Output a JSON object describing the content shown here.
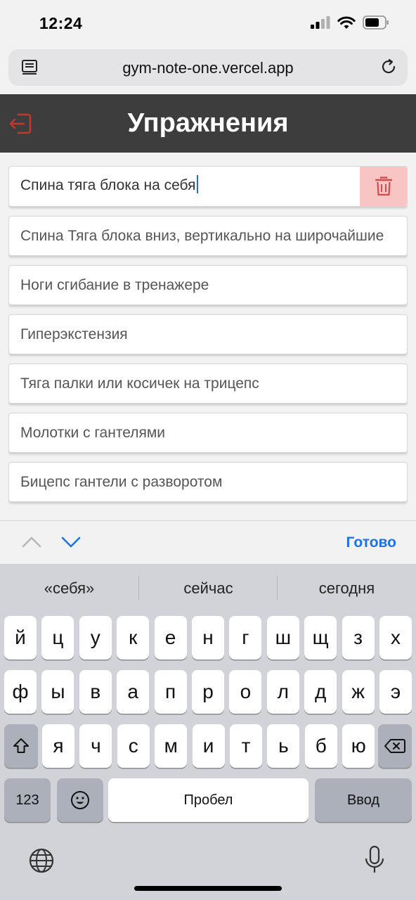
{
  "status_bar": {
    "time": "12:24"
  },
  "browser": {
    "url": "gym-note-one.vercel.app"
  },
  "header": {
    "title": "Упражнения"
  },
  "exercises": [
    {
      "name": "Спина тяга блока на себя",
      "editing": true
    },
    {
      "name": "Спина Тяга блока вниз, вертикально на широчайшие"
    },
    {
      "name": "Ноги сгибание в тренажере"
    },
    {
      "name": "Гиперэкстензия"
    },
    {
      "name": "Тяга палки или косичек на трицепс"
    },
    {
      "name": "Молотки с гантелями"
    },
    {
      "name": "Бицепс гантели с разворотом"
    }
  ],
  "accessory": {
    "done_label": "Готово"
  },
  "keyboard": {
    "suggestions": [
      "«себя»",
      "сейчас",
      "сегодня"
    ],
    "row1": [
      "й",
      "ц",
      "у",
      "к",
      "е",
      "н",
      "г",
      "ш",
      "щ",
      "з",
      "х"
    ],
    "row2": [
      "ф",
      "ы",
      "в",
      "а",
      "п",
      "р",
      "о",
      "л",
      "д",
      "ж",
      "э"
    ],
    "row3": [
      "я",
      "ч",
      "с",
      "м",
      "и",
      "т",
      "ь",
      "б",
      "ю"
    ],
    "numbers_label": "123",
    "space_label": "Пробел",
    "return_label": "Ввод"
  },
  "colors": {
    "header_bg": "#3d3d3d",
    "delete_bg": "#f8c4c4",
    "accent": "#1a73e8",
    "logout": "#c0392b"
  }
}
